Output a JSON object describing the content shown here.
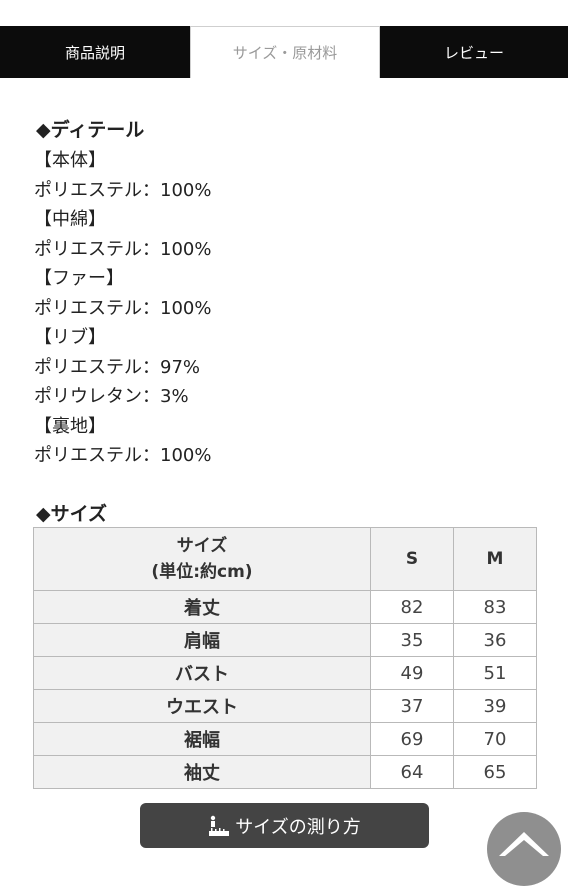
{
  "tabs": [
    {
      "label": "商品説明",
      "active": false
    },
    {
      "label": "サイズ・原材料",
      "active": true
    },
    {
      "label": "レビュー",
      "active": false
    }
  ],
  "details": {
    "heading": "◆ディテール",
    "lines": [
      "【本体】",
      "ポリエステル：100%",
      "【中綿】",
      "ポリエステル：100%",
      "【ファー】",
      "ポリエステル：100%",
      "【リブ】",
      "ポリエステル：97%",
      "ポリウレタン：3%",
      "【裏地】",
      "ポリエステル：100%"
    ]
  },
  "size": {
    "heading": "◆サイズ",
    "header_label_1": "サイズ",
    "header_label_2": "(単位:約cm)",
    "columns": [
      "S",
      "M"
    ],
    "rows": [
      {
        "label": "着丈",
        "values": [
          "82",
          "83"
        ]
      },
      {
        "label": "肩幅",
        "values": [
          "35",
          "36"
        ]
      },
      {
        "label": "バスト",
        "values": [
          "49",
          "51"
        ]
      },
      {
        "label": "ウエスト",
        "values": [
          "37",
          "39"
        ]
      },
      {
        "label": "裾幅",
        "values": [
          "69",
          "70"
        ]
      },
      {
        "label": "袖丈",
        "values": [
          "64",
          "65"
        ]
      }
    ]
  },
  "measure_button": {
    "label": "サイズの測り方",
    "icon": "ruler-figure-icon"
  },
  "scroll_top_button": {
    "icon": "chevron-up-icon"
  },
  "colors": {
    "tab_dark": "#0c0c0c",
    "button_dark": "#444444",
    "table_border": "#b9b9b9",
    "header_bg": "#f1f1f1",
    "top_button": "#8f8f8f"
  }
}
